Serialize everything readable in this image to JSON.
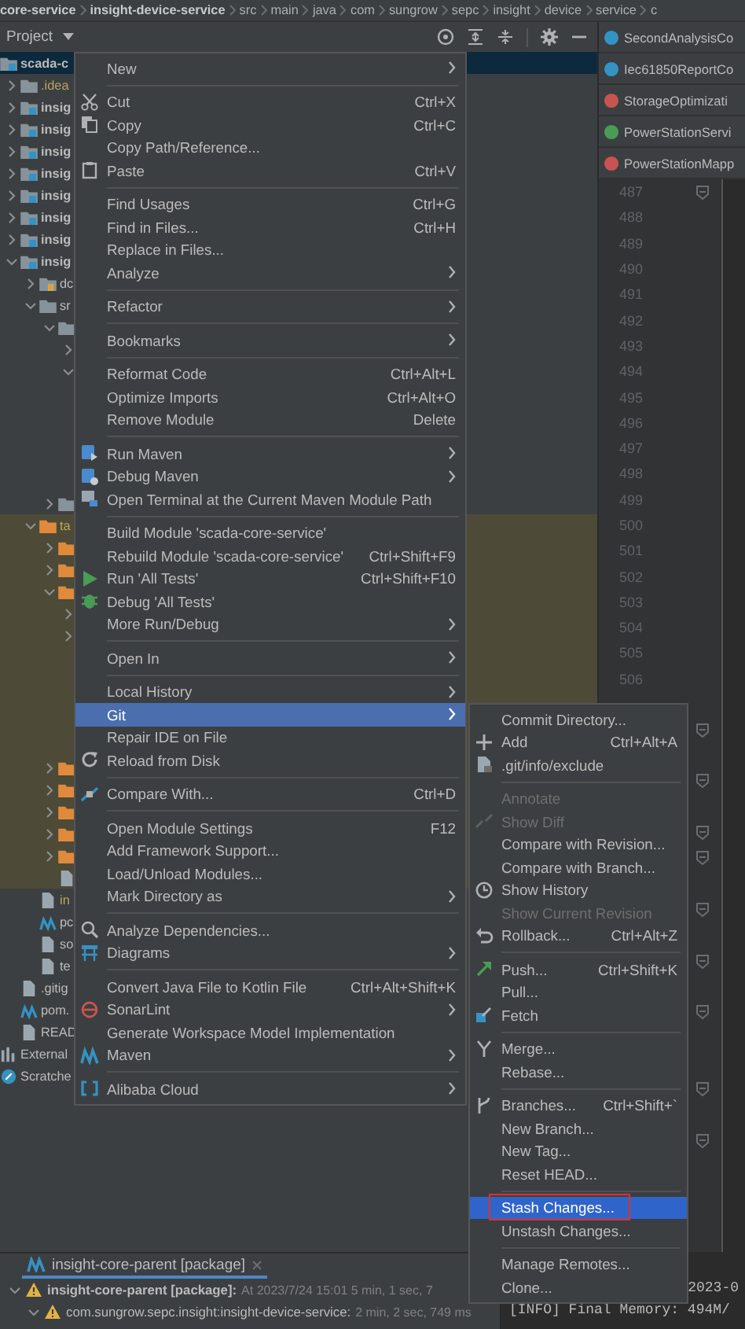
{
  "breadcrumb": [
    {
      "label": "core-service",
      "bold": true
    },
    {
      "label": "insight-device-service",
      "bold": true
    },
    {
      "label": "src",
      "bold": false
    },
    {
      "label": "main",
      "bold": false
    },
    {
      "label": "java",
      "bold": false
    },
    {
      "label": "com",
      "bold": false
    },
    {
      "label": "sungrow",
      "bold": false
    },
    {
      "label": "sepc",
      "bold": false
    },
    {
      "label": "insight",
      "bold": false
    },
    {
      "label": "device",
      "bold": false
    },
    {
      "label": "service",
      "bold": false
    },
    {
      "label": "c",
      "bold": false
    }
  ],
  "project_panel": {
    "title": "Project",
    "tree": [
      {
        "kind": "module",
        "label": "scada-c",
        "selected": true,
        "ignored": false,
        "children": [
          {
            "kind": "folder",
            "label": ".idea",
            "expanded": false,
            "selected": false,
            "ignored": true
          },
          {
            "kind": "module",
            "label": "insig",
            "expanded": false,
            "selected": false,
            "ignored": false
          },
          {
            "kind": "module",
            "label": "insig",
            "expanded": false,
            "selected": false,
            "ignored": false
          },
          {
            "kind": "module",
            "label": "insig",
            "expanded": false,
            "selected": false,
            "ignored": false
          },
          {
            "kind": "module",
            "label": "insig",
            "expanded": false,
            "selected": false,
            "ignored": false
          },
          {
            "kind": "module",
            "label": "insig",
            "expanded": false,
            "selected": false,
            "ignored": false
          },
          {
            "kind": "module",
            "label": "insig",
            "expanded": false,
            "selected": false,
            "ignored": false
          },
          {
            "kind": "module",
            "label": "insig",
            "expanded": false,
            "selected": false,
            "ignored": false
          },
          {
            "kind": "module",
            "label": "insig",
            "expanded": true,
            "selected": false,
            "ignored": false,
            "children": [
              {
                "kind": "source-folder",
                "label": "dc",
                "expanded": false,
                "selected": false,
                "ignored": false
              },
              {
                "kind": "folder",
                "label": "sr",
                "expanded": true,
                "selected": false,
                "ignored": false,
                "children": [
                  {
                    "kind": "folder",
                    "expanded": true,
                    "children": [
                      {
                        "kind": "node",
                        "expanded": false
                      },
                      {
                        "kind": "node",
                        "expanded": true,
                        "children": [
                          {
                            "kind": "covered"
                          },
                          {
                            "kind": "covered"
                          },
                          {
                            "kind": "covered"
                          },
                          {
                            "kind": "covered"
                          },
                          {
                            "kind": "covered"
                          }
                        ]
                      }
                    ]
                  },
                  {
                    "kind": "folder",
                    "expanded": false
                  }
                ]
              },
              {
                "kind": "target-folder",
                "label": "ta",
                "expanded": true,
                "selected": false,
                "ignored": true,
                "children": [
                  {
                    "kind": "target-folder",
                    "expanded": false
                  },
                  {
                    "kind": "target-folder",
                    "expanded": false
                  },
                  {
                    "kind": "target-folder",
                    "expanded": true,
                    "children": [
                      {
                        "kind": "node",
                        "expanded": false
                      },
                      {
                        "kind": "node",
                        "expanded": false
                      },
                      {
                        "kind": "covered"
                      },
                      {
                        "kind": "covered"
                      },
                      {
                        "kind": "covered"
                      },
                      {
                        "kind": "covered"
                      },
                      {
                        "kind": "covered"
                      }
                    ]
                  },
                  {
                    "kind": "target-folder",
                    "expanded": false
                  },
                  {
                    "kind": "target-folder",
                    "expanded": false
                  },
                  {
                    "kind": "target-folder",
                    "expanded": false
                  },
                  {
                    "kind": "target-folder",
                    "expanded": false
                  },
                  {
                    "kind": "target-folder",
                    "expanded": false
                  },
                  {
                    "kind": "file"
                  }
                ]
              },
              {
                "kind": "file",
                "label": "in",
                "selected": false,
                "ignored": true
              },
              {
                "kind": "maven-file",
                "label": "pc",
                "selected": false,
                "ignored": false
              },
              {
                "kind": "file",
                "label": "so",
                "selected": false,
                "ignored": false
              },
              {
                "kind": "file",
                "label": "te",
                "selected": false,
                "ignored": false
              }
            ]
          },
          {
            "kind": "file",
            "label": ".gitig",
            "selected": false,
            "ignored": false
          },
          {
            "kind": "maven-file",
            "label": "pom.",
            "selected": false,
            "ignored": false
          },
          {
            "kind": "file",
            "label": "READ",
            "selected": false,
            "ignored": false
          }
        ]
      },
      {
        "kind": "library",
        "label": "External",
        "selected": false,
        "ignored": false
      },
      {
        "kind": "scratches",
        "label": "Scratche",
        "selected": false,
        "ignored": false
      }
    ]
  },
  "editor": {
    "tabs": [
      {
        "label": "SecondAnalysisCo",
        "kind": "class"
      },
      {
        "label": "Iec61850ReportCo",
        "kind": "class"
      },
      {
        "label": "StorageOptimizati",
        "kind": "mapper"
      },
      {
        "label": "PowerStationServi",
        "kind": "interface"
      },
      {
        "label": "PowerStationMapp",
        "kind": "mapper"
      }
    ],
    "lines": [
      {
        "number": "487",
        "fold": true
      },
      {
        "number": "488",
        "fold": false
      },
      {
        "number": "489",
        "fold": false
      },
      {
        "number": "490",
        "fold": false
      },
      {
        "number": "491",
        "fold": false
      },
      {
        "number": "492",
        "fold": false
      },
      {
        "number": "493",
        "fold": false
      },
      {
        "number": "494",
        "fold": false
      },
      {
        "number": "495",
        "fold": false
      },
      {
        "number": "496",
        "fold": false
      },
      {
        "number": "497",
        "fold": false
      },
      {
        "number": "498",
        "fold": false
      },
      {
        "number": "499",
        "fold": false
      },
      {
        "number": "500",
        "fold": false
      },
      {
        "number": "501",
        "fold": false
      },
      {
        "number": "502",
        "fold": false
      },
      {
        "number": "503",
        "fold": false
      },
      {
        "number": "504",
        "fold": false
      },
      {
        "number": "505",
        "fold": false
      },
      {
        "number": "506",
        "fold": false
      },
      {
        "fold": false
      },
      {
        "fold": true
      },
      {
        "fold": false
      },
      {
        "fold": true
      },
      {
        "fold": false
      },
      {
        "fold": true
      },
      {
        "fold": true
      },
      {
        "fold": false
      },
      {
        "fold": true
      },
      {
        "fold": false
      },
      {
        "fold": true
      },
      {
        "fold": false
      },
      {
        "fold": true
      },
      {
        "fold": false
      },
      {
        "fold": false
      },
      {
        "fold": true
      },
      {
        "fold": false
      },
      {
        "fold": true
      },
      {
        "fold": false
      },
      {
        "fold": false
      },
      {
        "fold": false
      }
    ]
  },
  "context_menu": {
    "items": [
      {
        "kind": "text",
        "label": "New",
        "submenu": true,
        "selected": false
      },
      {
        "kind": "separator"
      },
      {
        "kind": "scissors",
        "label": "Cut",
        "shortcut": "Ctrl+X",
        "selected": false
      },
      {
        "kind": "copy",
        "label": "Copy",
        "shortcut": "Ctrl+C",
        "selected": false
      },
      {
        "kind": "text",
        "label": "Copy Path/Reference...",
        "selected": false
      },
      {
        "kind": "clipboard",
        "label": "Paste",
        "shortcut": "Ctrl+V",
        "selected": false
      },
      {
        "kind": "separator"
      },
      {
        "kind": "text",
        "label": "Find Usages",
        "shortcut": "Ctrl+G",
        "selected": false
      },
      {
        "kind": "text",
        "label": "Find in Files...",
        "shortcut": "Ctrl+H",
        "selected": false
      },
      {
        "kind": "text",
        "label": "Replace in Files...",
        "selected": false
      },
      {
        "kind": "text",
        "label": "Analyze",
        "submenu": true,
        "selected": false
      },
      {
        "kind": "separator"
      },
      {
        "kind": "text",
        "label": "Refactor",
        "submenu": true,
        "selected": false
      },
      {
        "kind": "separator"
      },
      {
        "kind": "text",
        "label": "Bookmarks",
        "submenu": true,
        "selected": false
      },
      {
        "kind": "separator"
      },
      {
        "kind": "text",
        "label": "Reformat Code",
        "shortcut": "Ctrl+Alt+L",
        "selected": false
      },
      {
        "kind": "text",
        "label": "Optimize Imports",
        "shortcut": "Ctrl+Alt+O",
        "selected": false
      },
      {
        "kind": "text",
        "label": "Remove Module",
        "shortcut": "Delete",
        "selected": false
      },
      {
        "kind": "separator"
      },
      {
        "kind": "maven-play",
        "label": "Run Maven",
        "submenu": true,
        "selected": false
      },
      {
        "kind": "maven-bug",
        "label": "Debug Maven",
        "submenu": true,
        "selected": false
      },
      {
        "kind": "terminal",
        "label": "Open Terminal at the Current Maven Module Path",
        "selected": false
      },
      {
        "kind": "separator"
      },
      {
        "kind": "text",
        "label": "Build Module 'scada-core-service'",
        "selected": false
      },
      {
        "kind": "text",
        "label": "Rebuild Module 'scada-core-service'",
        "shortcut": "Ctrl+Shift+F9",
        "selected": false
      },
      {
        "kind": "play",
        "label": "Run 'All Tests'",
        "shortcut": "Ctrl+Shift+F10",
        "selected": false
      },
      {
        "kind": "bug",
        "label": "Debug 'All Tests'",
        "selected": false
      },
      {
        "kind": "text",
        "label": "More Run/Debug",
        "submenu": true,
        "selected": false
      },
      {
        "kind": "separator"
      },
      {
        "kind": "text",
        "label": "Open In",
        "submenu": true,
        "selected": false
      },
      {
        "kind": "separator"
      },
      {
        "kind": "text",
        "label": "Local History",
        "submenu": true,
        "selected": false
      },
      {
        "kind": "text",
        "label": "Git",
        "submenu": true,
        "selected": true
      },
      {
        "kind": "text",
        "label": "Repair IDE on File",
        "selected": false
      },
      {
        "kind": "refresh",
        "label": "Reload from Disk",
        "selected": false
      },
      {
        "kind": "separator"
      },
      {
        "kind": "compare",
        "label": "Compare With...",
        "shortcut": "Ctrl+D",
        "selected": false
      },
      {
        "kind": "separator"
      },
      {
        "kind": "text",
        "label": "Open Module Settings",
        "shortcut": "F12",
        "selected": false
      },
      {
        "kind": "text",
        "label": "Add Framework Support...",
        "selected": false
      },
      {
        "kind": "text",
        "label": "Load/Unload Modules...",
        "selected": false
      },
      {
        "kind": "text",
        "label": "Mark Directory as",
        "submenu": true,
        "selected": false
      },
      {
        "kind": "separator"
      },
      {
        "kind": "magnifier",
        "label": "Analyze Dependencies...",
        "selected": false
      },
      {
        "kind": "diagram",
        "label": "Diagrams",
        "submenu": true,
        "selected": false
      },
      {
        "kind": "separator"
      },
      {
        "kind": "text",
        "label": "Convert Java File to Kotlin File",
        "shortcut": "Ctrl+Alt+Shift+K",
        "selected": false
      },
      {
        "kind": "sonar",
        "label": "SonarLint",
        "submenu": true,
        "selected": false
      },
      {
        "kind": "text",
        "label": "Generate Workspace Model Implementation",
        "selected": false
      },
      {
        "kind": "maven",
        "label": "Maven",
        "submenu": true,
        "selected": false
      },
      {
        "kind": "separator"
      },
      {
        "kind": "cloud",
        "label": "Alibaba Cloud",
        "submenu": true,
        "selected": false
      }
    ]
  },
  "git_submenu": {
    "items": [
      {
        "kind": "text",
        "label": "Commit Directory...",
        "selected": false,
        "disabled": false,
        "outlined": false
      },
      {
        "kind": "plus",
        "label": "Add",
        "shortcut": "Ctrl+Alt+A",
        "selected": false,
        "disabled": false,
        "outlined": false
      },
      {
        "kind": "file",
        "label": ".git/info/exclude",
        "selected": false,
        "disabled": false,
        "outlined": false
      },
      {
        "kind": "separator"
      },
      {
        "kind": "text",
        "label": "Annotate",
        "selected": false,
        "disabled": true,
        "outlined": false
      },
      {
        "kind": "diff",
        "label": "Show Diff",
        "selected": false,
        "disabled": true,
        "outlined": false
      },
      {
        "kind": "text",
        "label": "Compare with Revision...",
        "selected": false,
        "disabled": false,
        "outlined": false
      },
      {
        "kind": "text",
        "label": "Compare with Branch...",
        "selected": false,
        "disabled": false,
        "outlined": false
      },
      {
        "kind": "clock",
        "label": "Show History",
        "selected": false,
        "disabled": false,
        "outlined": false
      },
      {
        "kind": "text",
        "label": "Show Current Revision",
        "selected": false,
        "disabled": true,
        "outlined": false
      },
      {
        "kind": "undo",
        "label": "Rollback...",
        "shortcut": "Ctrl+Alt+Z",
        "selected": false,
        "disabled": false,
        "outlined": false
      },
      {
        "kind": "separator"
      },
      {
        "kind": "push",
        "label": "Push...",
        "shortcut": "Ctrl+Shift+K",
        "selected": false,
        "disabled": false,
        "outlined": false
      },
      {
        "kind": "text",
        "label": "Pull...",
        "selected": false,
        "disabled": false,
        "outlined": false
      },
      {
        "kind": "fetch",
        "label": "Fetch",
        "selected": false,
        "disabled": false,
        "outlined": false
      },
      {
        "kind": "separator"
      },
      {
        "kind": "merge",
        "label": "Merge...",
        "selected": false,
        "disabled": false,
        "outlined": false
      },
      {
        "kind": "text",
        "label": "Rebase...",
        "selected": false,
        "disabled": false,
        "outlined": false
      },
      {
        "kind": "separator"
      },
      {
        "kind": "branch",
        "label": "Branches...",
        "shortcut": "Ctrl+Shift+`",
        "selected": false,
        "disabled": false,
        "outlined": false
      },
      {
        "kind": "text",
        "label": "New Branch...",
        "selected": false,
        "disabled": false,
        "outlined": false
      },
      {
        "kind": "text",
        "label": "New Tag...",
        "selected": false,
        "disabled": false,
        "outlined": false
      },
      {
        "kind": "text",
        "label": "Reset HEAD...",
        "selected": false,
        "disabled": false,
        "outlined": false
      },
      {
        "kind": "separator"
      },
      {
        "kind": "text",
        "label": "Stash Changes...",
        "selected": true,
        "disabled": false,
        "outlined": true
      },
      {
        "kind": "text",
        "label": "Unstash Changes...",
        "selected": false,
        "disabled": false,
        "outlined": false
      },
      {
        "kind": "separator"
      },
      {
        "kind": "text",
        "label": "Manage Remotes...",
        "selected": false,
        "disabled": false,
        "outlined": false
      },
      {
        "kind": "text",
        "label": "Clone...",
        "selected": false,
        "disabled": false,
        "outlined": false
      }
    ]
  },
  "run_panel": {
    "tab": {
      "label": "insight-core-parent [package]"
    },
    "tree": [
      {
        "label": "insight-core-parent [package]:",
        "detail": "At 2023/7/24 15:01 5 min, 1 sec, 7",
        "kind": "warning",
        "expanded": true,
        "children": [
          {
            "label": "com.sungrow.sepc.insight:insight-device-service:",
            "detail": "2 min, 2 sec, 749 ms",
            "kind": "warning",
            "expanded": true
          }
        ]
      }
    ],
    "console": [
      "2023-0",
      "[INFO] Final Memory: 494M/"
    ]
  }
}
